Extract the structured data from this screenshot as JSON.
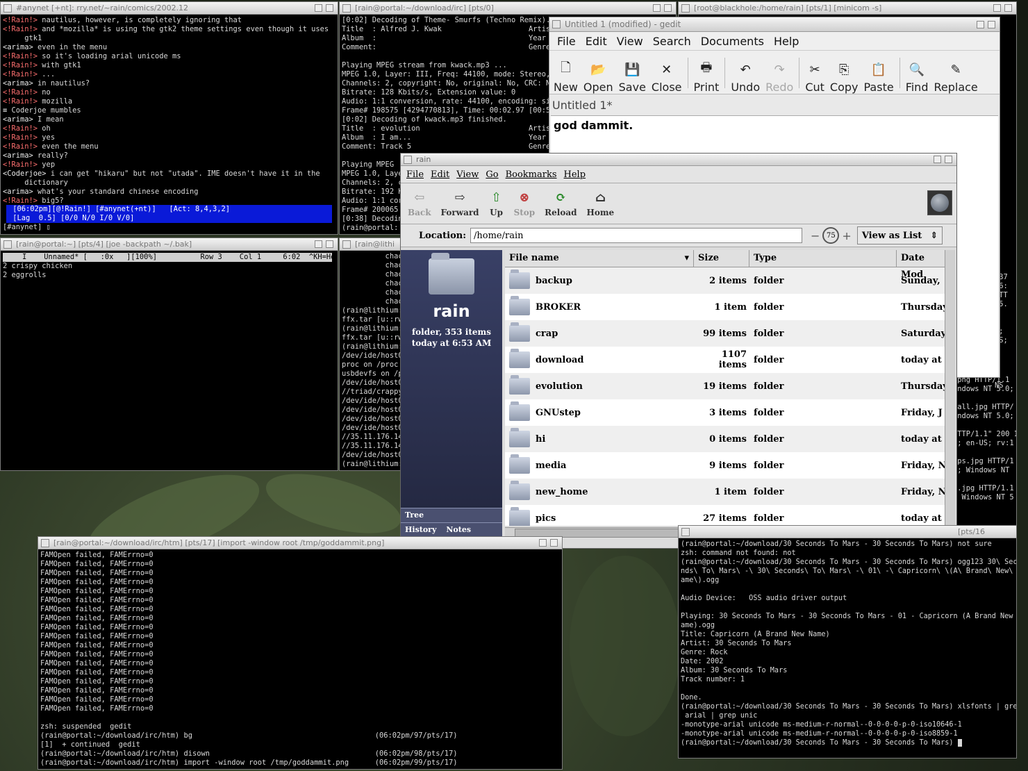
{
  "irc": {
    "title": "#anynet [+nt]: rry.net/~rain/comics/2002.12",
    "lines": [
      {
        "nick": "<!Rain!>",
        "text": " nautilus, however, is completely ignoring that"
      },
      {
        "nick": "<!Rain!>",
        "text": " and *mozilla* is using the gtk2 theme settings even though it uses"
      },
      {
        "nick": "",
        "text": "     gtk1"
      },
      {
        "nick": "<arima>",
        "text": " even in the menu"
      },
      {
        "nick": "<!Rain!>",
        "text": " so it's loading arial unicode ms"
      },
      {
        "nick": "<!Rain!>",
        "text": " with gtk1"
      },
      {
        "nick": "<!Rain!>",
        "text": " ..."
      },
      {
        "nick": "<arima>",
        "text": " in nautilus?"
      },
      {
        "nick": "<!Rain!>",
        "text": " no"
      },
      {
        "nick": "<!Rain!>",
        "text": " mozilla"
      },
      {
        "nick": "≡",
        "text": " Coderjoe mumbles"
      },
      {
        "nick": "<arima>",
        "text": " I mean"
      },
      {
        "nick": "<!Rain!>",
        "text": " oh"
      },
      {
        "nick": "<!Rain!>",
        "text": " yes"
      },
      {
        "nick": "<!Rain!>",
        "text": " even the menu"
      },
      {
        "nick": "<arima>",
        "text": " really?"
      },
      {
        "nick": "<!Rain!>",
        "text": " yep"
      },
      {
        "nick": "<Coderjoe>",
        "text": " i can get \"hikaru\" but not \"utada\". IME doesn't have it in the"
      },
      {
        "nick": "",
        "text": "     dictionary"
      },
      {
        "nick": "<arima>",
        "text": " what's your standard chinese encoding"
      },
      {
        "nick": "<!Rain!>",
        "text": " big5?"
      }
    ],
    "status1": " [06:02pm][@!Rain!] [#anynet(+nt)]   [Act: 8,4,3,2]",
    "status2": " [Lag  0.5] [0/0 N/0 I/0 V/0]",
    "prompt": "[#anynet] "
  },
  "mpg": {
    "title": "[rain@portal:~/download/irc] [pts/0]",
    "text": "[0:02] Decoding of Theme- Smurfs (Techno Remix).mp\nTitle  : Alfred J. Kwak                    Artist: K\nAlbum  :                                   Year  : \nComment:                                   Genre : \n\nPlaying MPEG stream from kwack.mp3 ...\nMPEG 1.0, Layer: III, Freq: 44100, mode: Stereo, m\nChannels: 2, copyright: No, original: No, CRC: No,\nBitrate: 128 Kbits/s, Extension value: 0\nAudio: 1:1 conversion, rate: 44100, encoding: sign\nFrame# 198575 [4294770813], Time: 00:02.97 [00:51.\n[0:02] Decoding of kwack.mp3 finished.\nTitle  : evolution                         Artist: H\nAlbum  : I am...                           Year  : \nComment: Track 5                           Genre : \n\nPlaying MPEG\nMPEG 1.0, Laye\nChannels: 2, c\nBitrate: 192 K\nAudio: 1:1 cor\nFrame# 200065\n[0:38] Decodin\n(rain@portal:"
  },
  "minicom": {
    "title": "[root@blackhole:/home/rain] [pts/1] [minicom -s]"
  },
  "joe": {
    "title": "[rain@portal:~] [pts/4] [joe -backpath ~/.bak]",
    "status": "    I    Unnamed* [   :0x   ][100%]          Row 3    Col 1     6:02  ^KH=Help",
    "text": "2 crispy chicken\n2 eggrolls"
  },
  "lithium": {
    "title": "[rain@lithi",
    "text": "          chacl\n          chacl\n          chacl\n          chacl\n          chacl\n          chacl\n(rain@lithium:\nffx.tar [u::rw\n(rain@lithium:\nffx.tar [u::rw\n(rain@lithium:\n/dev/ide/host0\nproc on /proc \nusbdevfs on /p\n/dev/ide/host0\n//triad/crappy\n/dev/ide/host0\n/dev/ide/host0\n/dev/ide/host0\n/dev/ide/host0\n//35.11.176.14\n//35.11.176.14\n/dev/ide/host0\n(rain@lithium:"
  },
  "right_term": {
    "fragment": ".37\n 6:\nHTT\n 5.\n\n\nS;\nUS;\n\n\n\n\nNS",
    "log": ".png HTTP/1.1\nindows NT 5.0;\n\nmall.jpg HTTP/\nindows NT 5.0;\n\nHTTP/1.1\" 200 10\n0; en-US; rv:1\n\nops.jpg HTTP/1\nU; Windows NT\n\nd.jpg HTTP/1.1\n; Windows NT 5"
  },
  "gedit": {
    "title": "Untitled 1 (modified) - gedit",
    "menu": [
      "File",
      "Edit",
      "View",
      "Search",
      "Documents",
      "Help"
    ],
    "tools": [
      {
        "label": "New",
        "icon": "🗋"
      },
      {
        "label": "Open",
        "icon": "📂"
      },
      {
        "label": "Save",
        "icon": "💾"
      },
      {
        "label": "Close",
        "icon": "✕"
      },
      {
        "label": "Print",
        "icon": "🖶"
      },
      {
        "label": "Undo",
        "icon": "↶"
      },
      {
        "label": "Redo",
        "icon": "↷"
      },
      {
        "label": "Cut",
        "icon": "✂"
      },
      {
        "label": "Copy",
        "icon": "⎘"
      },
      {
        "label": "Paste",
        "icon": "📋"
      },
      {
        "label": "Find",
        "icon": "🔍"
      },
      {
        "label": "Replace",
        "icon": "✎"
      }
    ],
    "tab": "Untitled 1*",
    "content": "god dammit."
  },
  "nautilus": {
    "title": "rain",
    "menu": [
      "File",
      "Edit",
      "View",
      "Go",
      "Bookmarks",
      "Help"
    ],
    "toolbar": {
      "back": "Back",
      "forward": "Forward",
      "up": "Up",
      "stop": "Stop",
      "reload": "Reload",
      "home": "Home"
    },
    "location_label": "Location:",
    "location": "/home/rain",
    "zoom": "75",
    "zoom_minus": "−",
    "zoom_plus": "+",
    "view_as": "View  as  List",
    "side": {
      "name": "rain",
      "info1": "folder, 353  items",
      "info2": "today  at  6:53  AM"
    },
    "side_tabs": {
      "tree": "Tree",
      "history": "History",
      "notes": "Notes"
    },
    "columns": {
      "name": "File  name",
      "size": "Size",
      "type": "Type",
      "date": "Date  Mod"
    },
    "files": [
      {
        "name": "backup",
        "size": "2  items",
        "type": "folder",
        "date": "Sunday,  "
      },
      {
        "name": "BROKER",
        "size": "1  item",
        "type": "folder",
        "date": "Thursday,"
      },
      {
        "name": "crap",
        "size": "99  items",
        "type": "folder",
        "date": "Saturday,"
      },
      {
        "name": "download",
        "size": "1107  items",
        "type": "folder",
        "date": "today  at"
      },
      {
        "name": "evolution",
        "size": "19  items",
        "type": "folder",
        "date": "Thursday,"
      },
      {
        "name": "GNUstep",
        "size": "3  items",
        "type": "folder",
        "date": "Friday,  J"
      },
      {
        "name": "hi",
        "size": "0  items",
        "type": "folder",
        "date": "today  at"
      },
      {
        "name": "media",
        "size": "9  items",
        "type": "folder",
        "date": "Friday,  N"
      },
      {
        "name": "new_home",
        "size": "1  item",
        "type": "folder",
        "date": "Friday,  N"
      },
      {
        "name": "pics",
        "size": "27  items",
        "type": "folder",
        "date": "today  at"
      }
    ]
  },
  "import_term": {
    "title": "[rain@portal:~/download/irc/htm] [pts/17] [import -window root /tmp/goddammit.png]",
    "text": "FAMOpen failed, FAMErrno=0\nFAMOpen failed, FAMErrno=0\nFAMOpen failed, FAMErrno=0\nFAMOpen failed, FAMErrno=0\nFAMOpen failed, FAMErrno=0\nFAMOpen failed, FAMErrno=0\nFAMOpen failed, FAMErrno=0\nFAMOpen failed, FAMErrno=0\nFAMOpen failed, FAMErrno=0\nFAMOpen failed, FAMErrno=0\nFAMOpen failed, FAMErrno=0\nFAMOpen failed, FAMErrno=0\nFAMOpen failed, FAMErrno=0\nFAMOpen failed, FAMErrno=0\nFAMOpen failed, FAMErrno=0\nFAMOpen failed, FAMErrno=0\nFAMOpen failed, FAMErrno=0\nFAMOpen failed, FAMErrno=0\n\nzsh: suspended  gedit\n(rain@portal:~/download/irc/htm) bg                                          (06:02pm/97/pts/17)\n[1]  + continued  gedit\n(rain@portal:~/download/irc/htm) disown                                      (06:02pm/98/pts/17)\n(rain@portal:~/download/irc/htm) import -window root /tmp/goddammit.png      (06:02pm/99/pts/17)"
  },
  "ogg_term": {
    "title": "[pts/16",
    "text": "(rain@portal:~/download/30 Seconds To Mars - 30 Seconds To Mars) not sure\nzsh: command not found: not\n(rain@portal:~/download/30 Seconds To Mars - 30 Seconds To Mars) ogg123 30\\ Seco\nnds\\ To\\ Mars\\ -\\ 30\\ Seconds\\ To\\ Mars\\ -\\ 01\\ -\\ Capricorn\\ \\(A\\ Brand\\ New\\ N\name\\).ogg\n\nAudio Device:   OSS audio driver output\n\nPlaying: 30 Seconds To Mars - 30 Seconds To Mars - 01 - Capricorn (A Brand New N\name).ogg\nTitle: Capricorn (A Brand New Name)\nArtist: 30 Seconds To Mars\nGenre: Rock\nDate: 2002\nAlbum: 30 Seconds To Mars\nTrack number: 1\n\nDone.\n(rain@portal:~/download/30 Seconds To Mars - 30 Seconds To Mars) xlsfonts | grep\n arial | grep unic\n-monotype-arial unicode ms-medium-r-normal--0-0-0-0-p-0-iso10646-1\n-monotype-arial unicode ms-medium-r-normal--0-0-0-0-p-0-iso8859-1\n(rain@portal:~/download/30 Seconds To Mars - 30 Seconds To Mars) "
  }
}
